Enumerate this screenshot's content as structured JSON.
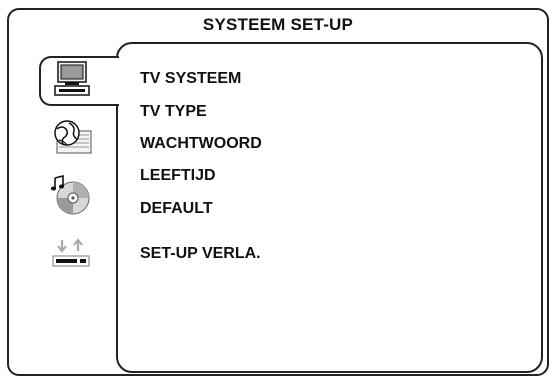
{
  "window": {
    "title": "SYSTEEM SET-UP"
  },
  "sidebar": {
    "icons": [
      {
        "name": "tv-monitor-icon",
        "selected": true
      },
      {
        "name": "language-globe-icon",
        "selected": false
      },
      {
        "name": "audio-disc-icon",
        "selected": false
      },
      {
        "name": "dvd-player-icon",
        "selected": false
      }
    ]
  },
  "menu": {
    "items": [
      {
        "label": "TV SYSTEEM"
      },
      {
        "label": "TV TYPE"
      },
      {
        "label": "WACHTWOORD"
      },
      {
        "label": "LEEFTIJD"
      },
      {
        "label": "DEFAULT"
      },
      {
        "label": "SET-UP VERLA."
      }
    ]
  }
}
